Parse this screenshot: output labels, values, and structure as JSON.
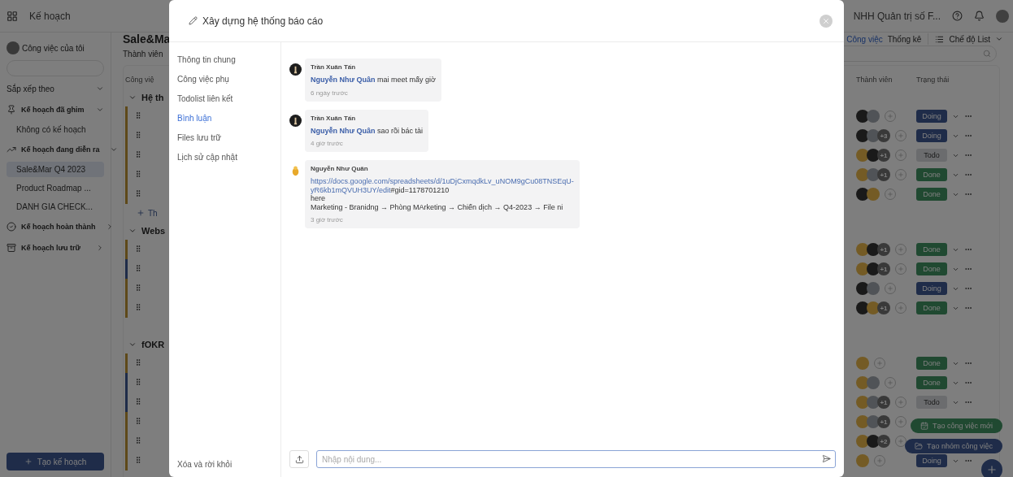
{
  "background": {
    "topbar": {
      "nav": "Kế hoạch",
      "org": "NHH Quản trị số F..."
    },
    "sidebar": {
      "my_tasks": "Công việc của tôi",
      "sort": "Sắp xếp theo",
      "sections": [
        {
          "title": "Kế hoạch đã ghim",
          "expanded": true,
          "empty": "Không có kế hoạch"
        },
        {
          "title": "Kế hoạch đang diễn ra",
          "expanded": true,
          "items": [
            {
              "label": "Sale&Mar Q4 2023",
              "selected": true
            },
            {
              "label": "Product Roadmap ...",
              "selected": false
            },
            {
              "label": "DANH GIA CHECK...",
              "selected": false
            }
          ]
        },
        {
          "title": "Kế hoạch hoàn thành",
          "expanded": false
        },
        {
          "title": "Kế hoạch lưu trữ",
          "expanded": false
        }
      ],
      "create_button": "Tạo kế hoạch"
    },
    "main": {
      "title": "Sale&Ma",
      "filter": "Thành viên",
      "views": [
        {
          "label": "Công việc",
          "selected": true
        },
        {
          "label": "Thống kê",
          "selected": false
        }
      ],
      "view_mode": "Chế độ List",
      "columns": [
        "Công việ",
        "Thành viên",
        "Trạng thái"
      ],
      "groups": [
        {
          "name": "Hệ th",
          "add": "Th",
          "rows": [
            {
              "color": "#5e4919",
              "avatars": [
                {
                  "kind": "dark"
                },
                {
                  "kind": "person"
                }
              ],
              "status": "Doing"
            },
            {
              "color": "#5e4919",
              "avatars": [
                {
                  "kind": "dark"
                },
                {
                  "kind": "person"
                }
              ],
              "extra": "+3",
              "status": "Doing"
            },
            {
              "color": "#5e4919",
              "avatars": [
                {
                  "kind": "bird"
                },
                {
                  "kind": "dark"
                }
              ],
              "extra": "+1",
              "status": "Todo"
            },
            {
              "color": "#5e4919",
              "avatars": [
                {
                  "kind": "bird"
                },
                {
                  "kind": "person"
                }
              ],
              "extra": "+1",
              "status": "Done"
            },
            {
              "color": "#5e4919",
              "avatars": [
                {
                  "kind": "dark"
                },
                {
                  "kind": "bird"
                }
              ],
              "status": "Done"
            }
          ]
        },
        {
          "name": "Webs",
          "rows": [
            {
              "color": "#5e4919",
              "avatars": [
                {
                  "kind": "bird"
                },
                {
                  "kind": "dark"
                }
              ],
              "extra": "+1",
              "status": "Done"
            },
            {
              "color": "#1f2c49",
              "avatars": [
                {
                  "kind": "bird"
                },
                {
                  "kind": "dark"
                }
              ],
              "extra": "+1",
              "status": "Done"
            },
            {
              "color": "#5e4919",
              "avatars": [
                {
                  "kind": "dark"
                },
                {
                  "kind": "person"
                }
              ],
              "status": "Doing"
            },
            {
              "color": "#5e4919",
              "avatars": [
                {
                  "kind": "dark"
                },
                {
                  "kind": "bird"
                }
              ],
              "extra": "+1",
              "status": "Done"
            }
          ]
        },
        {
          "name": "fOKR",
          "rows": [
            {
              "color": "#5e4919",
              "avatars": [
                {
                  "kind": "bird"
                }
              ],
              "status": "Done"
            },
            {
              "color": "#1f2c49",
              "avatars": [
                {
                  "kind": "bird"
                },
                {
                  "kind": "person"
                }
              ],
              "status": "Done"
            },
            {
              "color": "#1f2c49",
              "avatars": [
                {
                  "kind": "bird"
                },
                {
                  "kind": "person"
                }
              ],
              "extra": "+1",
              "status": "Todo"
            },
            {
              "color": "#5e4919",
              "avatars": [
                {
                  "kind": "bird"
                },
                {
                  "kind": "person"
                }
              ],
              "extra": "+1"
            },
            {
              "color": "#5e4919",
              "avatars": [
                {
                  "kind": "bird"
                },
                {
                  "kind": "dark"
                }
              ],
              "extra": "+2"
            },
            {
              "color": "#5e4919",
              "avatars": [
                {
                  "kind": "bird"
                }
              ],
              "status": "Doing"
            }
          ]
        }
      ],
      "fab_actions": [
        {
          "label": "Tạo công việc mới",
          "kind": "task"
        },
        {
          "label": "Tạo nhóm công việc",
          "kind": "group"
        }
      ]
    }
  },
  "modal": {
    "title": "Xây dựng hệ thống báo cáo",
    "nav": [
      {
        "label": "Thông tin chung",
        "selected": false
      },
      {
        "label": "Công việc phụ",
        "selected": false
      },
      {
        "label": "Todolist liên kết",
        "selected": false
      },
      {
        "label": "Bình luận",
        "selected": true
      },
      {
        "label": "Files lưu trữ",
        "selected": false
      },
      {
        "label": "Lịch sử cập nhật",
        "selected": false
      }
    ],
    "leave": "Xóa và rời khỏi",
    "comments": [
      {
        "author": "Trần Xuân Tấn",
        "avatar": {
          "kind": "dark"
        },
        "lines": [
          [
            {
              "kind": "mention",
              "text": "Nguyễn Như Quân"
            },
            {
              "kind": "text",
              "text": " mai meet mấy giờ"
            }
          ]
        ],
        "time": "6 ngày trước"
      },
      {
        "author": "Trần Xuân Tấn",
        "avatar": {
          "kind": "dark"
        },
        "lines": [
          [
            {
              "kind": "mention",
              "text": "Nguyễn Như Quân"
            },
            {
              "kind": "text",
              "text": " sao rồi bác tài"
            }
          ]
        ],
        "time": "4 giờ trước"
      },
      {
        "author": "Nguyễn Như Quân",
        "avatar": {
          "kind": "bird"
        },
        "lines": [
          [
            {
              "kind": "link",
              "text": "https://docs.google.com/spreadsheets/d/1uDjCxmqdkLv_uNOM9gCu08TNSEqU-"
            }
          ],
          [
            {
              "kind": "link",
              "text": "yR6kb1mQVUH3UY/edit"
            },
            {
              "kind": "text",
              "text": "#gid=1178701210"
            }
          ],
          [
            {
              "kind": "text",
              "text": "here"
            }
          ],
          [
            {
              "kind": "text",
              "text": "Marketing - Branidng → Phòng MArketing → Chiến dịch → Q4-2023 → File ni"
            }
          ]
        ],
        "time": "3 giờ trước"
      }
    ],
    "input": {
      "placeholder": "Nhập nội dung..."
    }
  }
}
